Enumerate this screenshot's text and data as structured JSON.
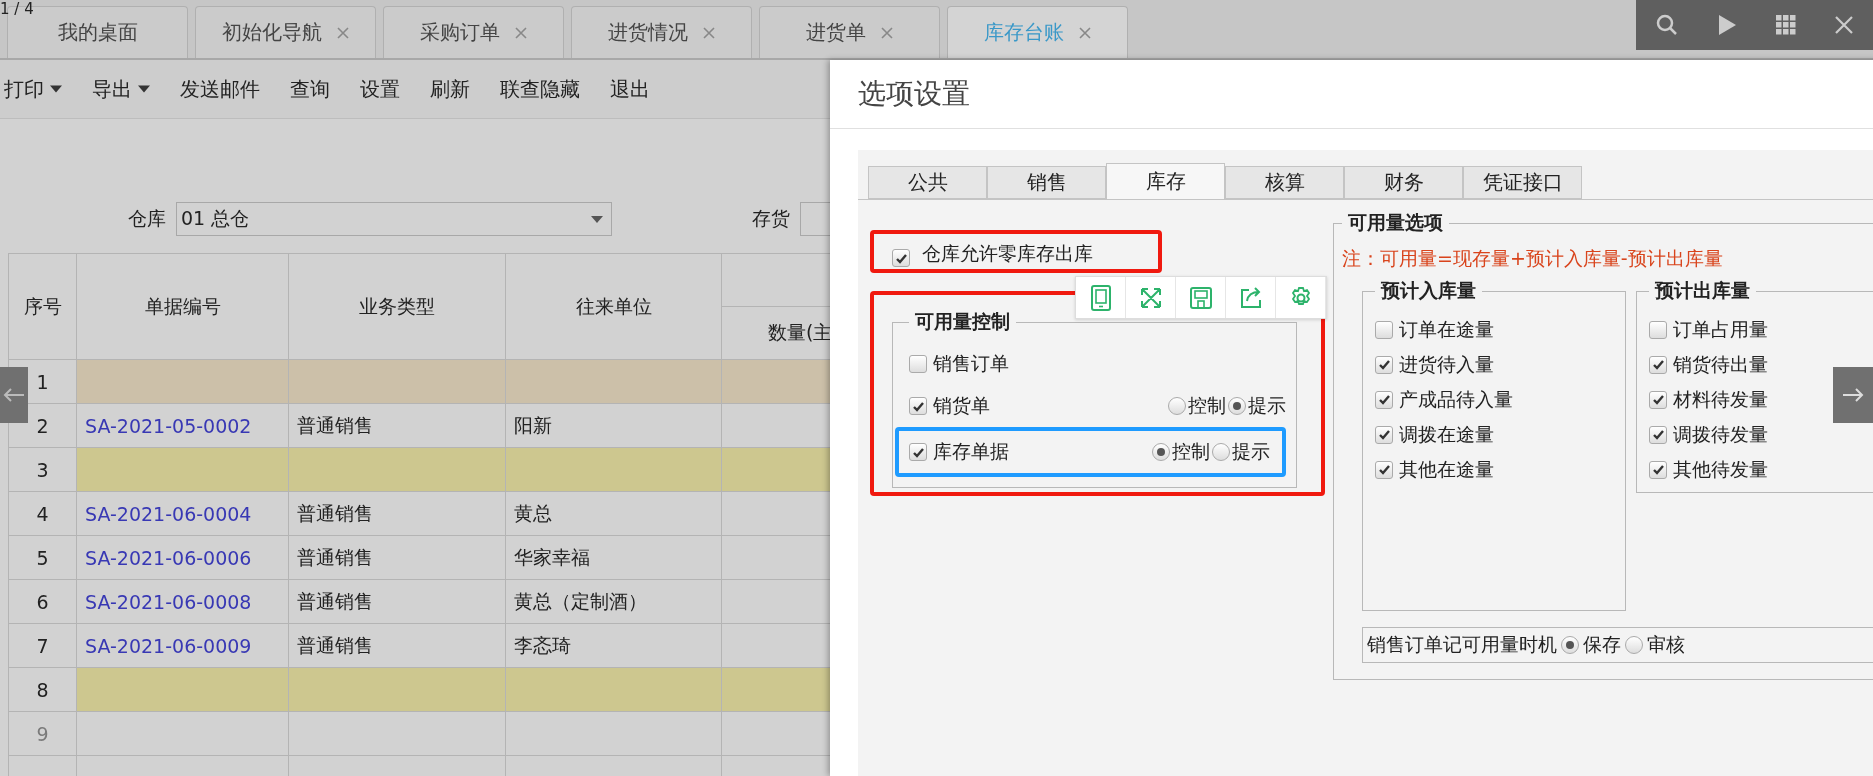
{
  "viewer": {
    "page_counter": "1 / 4"
  },
  "tabs": [
    {
      "label": "我的桌面",
      "closable": false,
      "selected": false
    },
    {
      "label": "初始化导航",
      "closable": true,
      "selected": false
    },
    {
      "label": "采购订单",
      "closable": true,
      "selected": false
    },
    {
      "label": "进货情况",
      "closable": true,
      "selected": false
    },
    {
      "label": "进货单",
      "closable": true,
      "selected": false
    },
    {
      "label": "库存台账",
      "closable": true,
      "selected": true
    }
  ],
  "toolbar": [
    {
      "label": "打印",
      "dropdown": true
    },
    {
      "label": "导出",
      "dropdown": true
    },
    {
      "label": "发送邮件",
      "dropdown": false
    },
    {
      "label": "查询",
      "dropdown": false
    },
    {
      "label": "设置",
      "dropdown": false
    },
    {
      "label": "刷新",
      "dropdown": false
    },
    {
      "label": "联查隐藏",
      "dropdown": false
    },
    {
      "label": "退出",
      "dropdown": false
    }
  ],
  "filters": {
    "warehouse_label": "仓库",
    "warehouse_value": "01 总仓",
    "inventory_label": "存货"
  },
  "table": {
    "columns": [
      "序号",
      "单据编号",
      "业务类型",
      "往来单位"
    ],
    "column_5": "数量(主",
    "rows": [
      {
        "no": "1",
        "color": "#ccc0a9",
        "disabled": false
      },
      {
        "no": "2",
        "doc_no": "SA-2021-05-0002",
        "type": "普通销售",
        "partner": "阳新",
        "disabled": false
      },
      {
        "no": "3",
        "color": "#cdc78f",
        "disabled": false
      },
      {
        "no": "4",
        "doc_no": "SA-2021-06-0004",
        "type": "普通销售",
        "partner": "黄总",
        "disabled": false
      },
      {
        "no": "5",
        "doc_no": "SA-2021-06-0006",
        "type": "普通销售",
        "partner": "华家幸福",
        "disabled": false
      },
      {
        "no": "6",
        "doc_no": "SA-2021-06-0008",
        "type": "普通销售",
        "partner": "黄总（定制酒）",
        "disabled": false
      },
      {
        "no": "7",
        "doc_no": "SA-2021-06-0009",
        "type": "普通销售",
        "partner": "李忞琦",
        "disabled": false
      },
      {
        "no": "8",
        "color": "#cdc78f",
        "disabled": false
      },
      {
        "no": "9",
        "disabled": true
      }
    ]
  },
  "dialog": {
    "title": "选项设置",
    "tabs": [
      {
        "label": "公共",
        "selected": false
      },
      {
        "label": "销售",
        "selected": false
      },
      {
        "label": "库存",
        "selected": true
      },
      {
        "label": "核算",
        "selected": false
      },
      {
        "label": "财务",
        "selected": false
      },
      {
        "label": "凭证接口",
        "selected": false
      }
    ],
    "zero_stock": {
      "label": "仓库允许零库存出库",
      "checked": true
    },
    "control_group": {
      "title": "可用量控制",
      "items": [
        {
          "label": "销售订单",
          "checked": false
        },
        {
          "label": "销货单",
          "checked": true,
          "options": [
            {
              "label": "控制",
              "selected": false
            },
            {
              "label": "提示",
              "selected": true
            }
          ]
        },
        {
          "label": "库存单据",
          "checked": true,
          "options": [
            {
              "label": "控制",
              "selected": true
            },
            {
              "label": "提示",
              "selected": false
            }
          ]
        }
      ]
    },
    "options_group": {
      "title": "可用量选项",
      "note": "注：可用量=现存量+预计入库量-预计出库量",
      "inbound": {
        "title": "预计入库量",
        "items": [
          {
            "label": "订单在途量",
            "checked": false
          },
          {
            "label": "进货待入量",
            "checked": true
          },
          {
            "label": "产成品待入量",
            "checked": true
          },
          {
            "label": "调拨在途量",
            "checked": true
          },
          {
            "label": "其他在途量",
            "checked": true
          }
        ]
      },
      "outbound": {
        "title": "预计出库量",
        "items": [
          {
            "label": "订单占用量",
            "checked": false
          },
          {
            "label": "销货待出量",
            "checked": true
          },
          {
            "label": "材料待发量",
            "checked": true
          },
          {
            "label": "调拨待发量",
            "checked": true
          },
          {
            "label": "其他待发量",
            "checked": true
          }
        ]
      },
      "timing": {
        "label": "销售订单记可用量时机",
        "options": [
          {
            "label": "保存",
            "selected": true
          },
          {
            "label": "审核",
            "selected": false
          }
        ]
      }
    }
  }
}
